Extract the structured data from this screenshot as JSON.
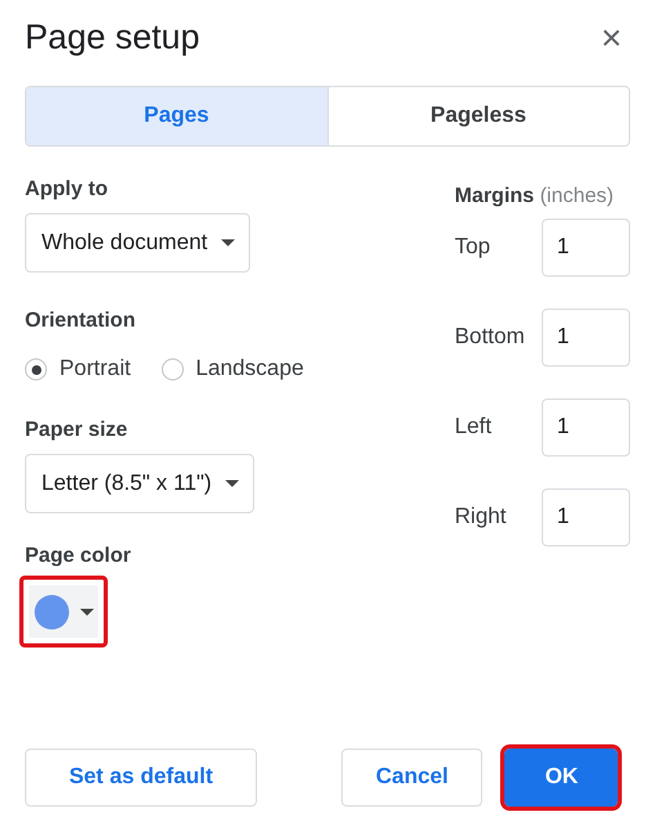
{
  "dialog": {
    "title": "Page setup",
    "close": "×"
  },
  "tabs": [
    {
      "label": "Pages",
      "selected": true
    },
    {
      "label": "Pageless",
      "selected": false
    }
  ],
  "apply_to": {
    "label": "Apply to",
    "value": "Whole document"
  },
  "orientation": {
    "label": "Orientation",
    "options": [
      {
        "label": "Portrait",
        "selected": true
      },
      {
        "label": "Landscape",
        "selected": false
      }
    ]
  },
  "paper_size": {
    "label": "Paper size",
    "value": "Letter (8.5\" x 11\")"
  },
  "page_color": {
    "label": "Page color",
    "color": "#6495ed",
    "highlighted": true
  },
  "margins": {
    "label": "Margins",
    "unit": "(inches)",
    "fields": [
      {
        "label": "Top",
        "value": "1"
      },
      {
        "label": "Bottom",
        "value": "1"
      },
      {
        "label": "Left",
        "value": "1"
      },
      {
        "label": "Right",
        "value": "1"
      }
    ]
  },
  "buttons": [
    {
      "label": "Set as default",
      "kind": "outline",
      "highlighted": false
    },
    {
      "label": "Cancel",
      "kind": "outline",
      "highlighted": false
    },
    {
      "label": "OK",
      "kind": "primary",
      "highlighted": true
    }
  ]
}
